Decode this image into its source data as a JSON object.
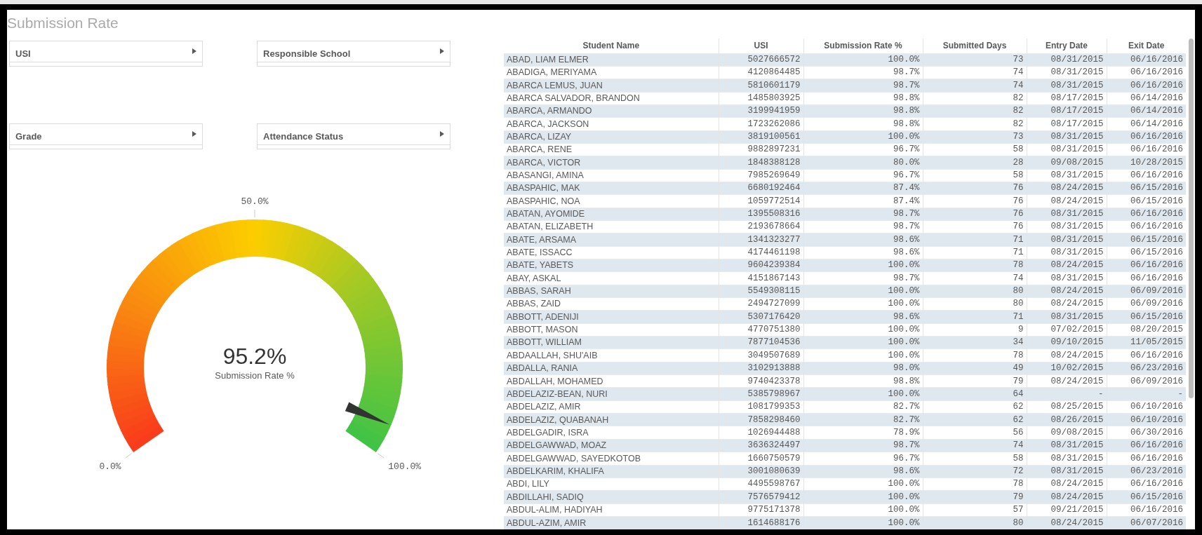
{
  "title": "Submission Rate",
  "filters": [
    {
      "label": "USI"
    },
    {
      "label": "Responsible School"
    },
    {
      "label": "Grade"
    },
    {
      "label": "Attendance Status"
    }
  ],
  "gauge": {
    "value": "95.2%",
    "label": "Submission Rate %",
    "level": 0.952,
    "min_label": "0.0%",
    "mid_label": "50.0%",
    "max_label": "100.0%"
  },
  "table": {
    "columns": [
      "Student Name",
      "USI",
      "Submission Rate %",
      "Submitted Days",
      "Entry Date",
      "Exit Date"
    ],
    "rows": [
      [
        "ABAD, LIAM ELMER",
        "5027666572",
        "100.0%",
        "73",
        "08/31/2015",
        "06/16/2016"
      ],
      [
        "ABADIGA, MERIYAMA",
        "4120864485",
        "98.7%",
        "74",
        "08/31/2015",
        "06/16/2016"
      ],
      [
        "ABARCA LEMUS, JUAN",
        "5810601179",
        "98.7%",
        "74",
        "08/31/2015",
        "06/16/2016"
      ],
      [
        "ABARCA SALVADOR, BRANDON",
        "1485803925",
        "98.8%",
        "82",
        "08/17/2015",
        "06/14/2016"
      ],
      [
        "ABARCA, ARMANDO",
        "3199941959",
        "98.8%",
        "82",
        "08/17/2015",
        "06/14/2016"
      ],
      [
        "ABARCA, JACKSON",
        "1723262086",
        "98.8%",
        "82",
        "08/17/2015",
        "06/14/2016"
      ],
      [
        "ABARCA, LIZAY",
        "3819100561",
        "100.0%",
        "73",
        "08/31/2015",
        "06/16/2016"
      ],
      [
        "ABARCA, RENE",
        "9882897231",
        "96.7%",
        "58",
        "08/31/2015",
        "06/16/2016"
      ],
      [
        "ABARCA, VICTOR",
        "1848388128",
        "80.0%",
        "28",
        "09/08/2015",
        "10/28/2015"
      ],
      [
        "ABASANGI, AMINA",
        "7985269649",
        "96.7%",
        "58",
        "08/31/2015",
        "06/16/2016"
      ],
      [
        "ABASPAHIC, MAK",
        "6680192464",
        "87.4%",
        "76",
        "08/24/2015",
        "06/15/2016"
      ],
      [
        "ABASPAHIC, NOA",
        "1059772514",
        "87.4%",
        "76",
        "08/24/2015",
        "06/15/2016"
      ],
      [
        "ABATAN, AYOMIDE",
        "1395508316",
        "98.7%",
        "76",
        "08/31/2015",
        "06/16/2016"
      ],
      [
        "ABATAN, ELIZABETH",
        "2193678664",
        "98.7%",
        "76",
        "08/31/2015",
        "06/16/2016"
      ],
      [
        "ABATE, ARSAMA",
        "1341323277",
        "98.6%",
        "71",
        "08/31/2015",
        "06/15/2016"
      ],
      [
        "ABATE, ISSACC",
        "4174461198",
        "98.6%",
        "71",
        "08/31/2015",
        "06/15/2016"
      ],
      [
        "ABATE, YABETS",
        "9604239384",
        "100.0%",
        "78",
        "08/24/2015",
        "06/16/2016"
      ],
      [
        "ABAY, ASKAL",
        "4151867143",
        "98.7%",
        "74",
        "08/31/2015",
        "06/16/2016"
      ],
      [
        "ABBAS, SARAH",
        "5549308115",
        "100.0%",
        "80",
        "08/24/2015",
        "06/09/2016"
      ],
      [
        "ABBAS, ZAID",
        "2494727099",
        "100.0%",
        "80",
        "08/24/2015",
        "06/09/2016"
      ],
      [
        "ABBOTT, ADENIJI",
        "5307176420",
        "98.6%",
        "71",
        "08/31/2015",
        "06/15/2016"
      ],
      [
        "ABBOTT, MASON",
        "4770751380",
        "100.0%",
        "9",
        "07/02/2015",
        "08/20/2015"
      ],
      [
        "ABBOTT, WILLIAM",
        "7877104536",
        "100.0%",
        "34",
        "09/10/2015",
        "11/05/2015"
      ],
      [
        "ABDAALLAH, SHU'AIB",
        "3049507689",
        "100.0%",
        "78",
        "08/24/2015",
        "06/16/2016"
      ],
      [
        "ABDALLA, RANIA",
        "3102913888",
        "98.0%",
        "49",
        "10/02/2015",
        "06/23/2016"
      ],
      [
        "ABDALLAH, MOHAMED",
        "9740423378",
        "98.8%",
        "79",
        "08/24/2015",
        "06/09/2016"
      ],
      [
        "ABDELAZIZ-BEAN, NURI",
        "5385798967",
        "100.0%",
        "64",
        "-",
        "-"
      ],
      [
        "ABDELAZIZ, AMIR",
        "1081799353",
        "82.7%",
        "62",
        "08/25/2015",
        "06/10/2016"
      ],
      [
        "ABDELAZIZ, QUABANAH",
        "7858298460",
        "82.7%",
        "62",
        "08/26/2015",
        "06/10/2016"
      ],
      [
        "ABDELGADIR, ISRA",
        "1026944488",
        "78.9%",
        "56",
        "09/08/2015",
        "06/30/2016"
      ],
      [
        "ABDELGAWWAD, MOAZ",
        "3636324497",
        "98.7%",
        "74",
        "08/31/2015",
        "06/16/2016"
      ],
      [
        "ABDELGAWWAD, SAYEDKOTOB",
        "1660750579",
        "96.7%",
        "58",
        "08/31/2015",
        "06/16/2016"
      ],
      [
        "ABDELKARIM, KHALIFA",
        "3001080639",
        "98.6%",
        "72",
        "08/31/2015",
        "06/23/2016"
      ],
      [
        "ABDI, LILY",
        "4495598767",
        "100.0%",
        "78",
        "08/24/2015",
        "06/16/2016"
      ],
      [
        "ABDILLAHI, SADIQ",
        "7576579412",
        "100.0%",
        "79",
        "08/24/2015",
        "06/15/2016"
      ],
      [
        "ABDUL-ALIM, HADIYAH",
        "9775171378",
        "100.0%",
        "57",
        "09/21/2015",
        "06/16/2016"
      ],
      [
        "ABDUL-AZIM, AMIR",
        "1614688176",
        "100.0%",
        "80",
        "08/24/2015",
        "06/07/2016"
      ]
    ]
  }
}
